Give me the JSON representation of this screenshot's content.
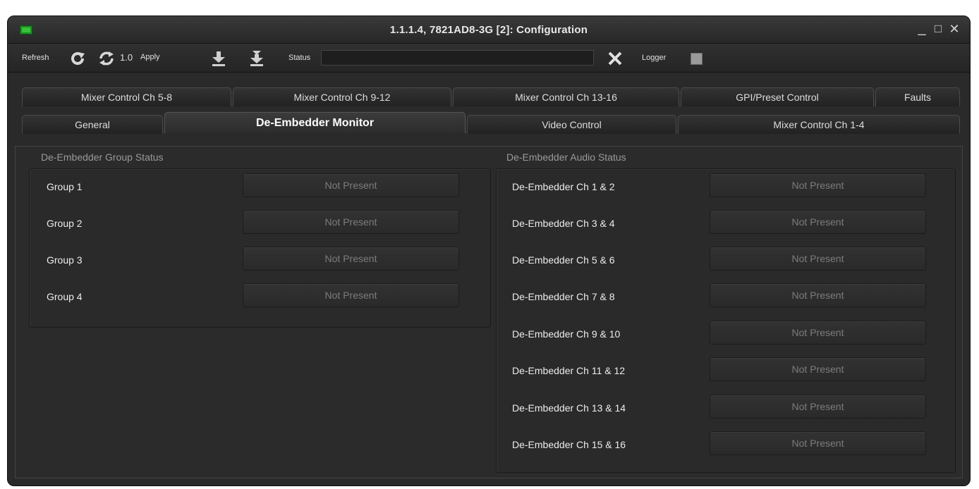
{
  "window": {
    "title": "1.1.1.4, 7821AD8-3G  [2]: Configuration",
    "icons": {
      "app": "card-icon",
      "minimize": "minimize-icon",
      "maximize": "maximize-icon",
      "close": "close-icon"
    },
    "controls": {
      "minimize": "_",
      "maximize": "□",
      "close": "✕"
    }
  },
  "toolbar": {
    "refresh_label": "Refresh",
    "speed_value": "1.0",
    "apply_label": "Apply",
    "status_label": "Status",
    "status_value": "",
    "logger_label": "Logger",
    "icons": [
      "refresh-icon",
      "auto-refresh-icon",
      "download-icon",
      "download-all-icon",
      "clear-status-icon",
      "logger-toggle-icon"
    ]
  },
  "tabs_row1": [
    {
      "label": "Mixer Control Ch 5-8"
    },
    {
      "label": "Mixer Control Ch 9-12"
    },
    {
      "label": "Mixer Control Ch 13-16"
    },
    {
      "label": "GPI/Preset Control"
    },
    {
      "label": "Faults"
    }
  ],
  "tabs_row2": [
    {
      "label": "General"
    },
    {
      "label": "De-Embedder Monitor",
      "active": true
    },
    {
      "label": "Video Control"
    },
    {
      "label": "Mixer Control Ch 1-4"
    }
  ],
  "group_status": {
    "title": "De-Embedder Group Status",
    "rows": [
      {
        "label": "Group 1",
        "status": "Not Present"
      },
      {
        "label": "Group 2",
        "status": "Not Present"
      },
      {
        "label": "Group 3",
        "status": "Not Present"
      },
      {
        "label": "Group 4",
        "status": "Not Present"
      }
    ]
  },
  "audio_status": {
    "title": "De-Embedder Audio Status",
    "rows": [
      {
        "label": "De-Embedder Ch 1 & 2",
        "status": "Not Present"
      },
      {
        "label": "De-Embedder Ch 3 & 4",
        "status": "Not Present"
      },
      {
        "label": "De-Embedder Ch 5 & 6",
        "status": "Not Present"
      },
      {
        "label": "De-Embedder Ch 7 & 8",
        "status": "Not Present"
      },
      {
        "label": "De-Embedder Ch 9 & 10",
        "status": "Not Present"
      },
      {
        "label": "De-Embedder Ch 11 & 12",
        "status": "Not Present"
      },
      {
        "label": "De-Embedder Ch 13 & 14",
        "status": "Not Present"
      },
      {
        "label": "De-Embedder Ch 15 & 16",
        "status": "Not Present"
      }
    ]
  },
  "colors": {
    "window_bg": "#2a2a2a",
    "app_icon": "#39c13a",
    "status_text_disabled": "#7c7c7c"
  }
}
